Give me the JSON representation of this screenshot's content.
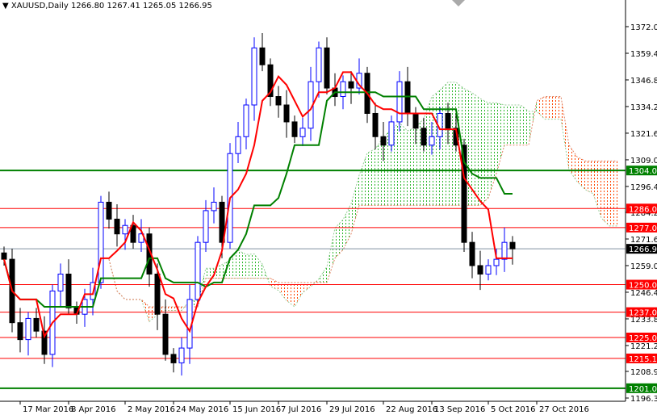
{
  "header": {
    "symbol": "XAUUSD,Daily",
    "ohlc": "1266.80 1267.41 1265.05 1266.95"
  },
  "chart_data": {
    "type": "candlestick",
    "title": "XAUUSD,Daily",
    "ylim": [
      1196.35,
      1372.05
    ],
    "y_ticks": [
      "1372.05",
      "1359.45",
      "1346.85",
      "1334.25",
      "1321.65",
      "1309.05",
      "1296.45",
      "1284.20",
      "1271.60",
      "1259.00",
      "1246.40",
      "1233.80",
      "1221.20",
      "1208.95",
      "1196.35"
    ],
    "x_ticks": [
      {
        "label": "17 Mar 2016",
        "i": 2
      },
      {
        "label": "8 Apr 2016",
        "i": 8
      },
      {
        "label": "2 May 2016",
        "i": 15
      },
      {
        "label": "24 May 2016",
        "i": 21
      },
      {
        "label": "15 Jun 2016",
        "i": 28
      },
      {
        "label": "7 Jul 2016",
        "i": 34
      },
      {
        "label": "29 Jul 2016",
        "i": 40
      },
      {
        "label": "22 Aug 2016",
        "i": 47
      },
      {
        "label": "13 Sep 2016",
        "i": 53
      },
      {
        "label": "5 Oct 2016",
        "i": 60
      },
      {
        "label": "27 Oct 2016",
        "i": 66
      }
    ],
    "closes": [
      1262,
      1232,
      1224,
      1234,
      1228,
      1217,
      1247,
      1255,
      1239,
      1236,
      1243,
      1251,
      1289,
      1281,
      1274,
      1278,
      1270,
      1274,
      1255,
      1236,
      1217,
      1213,
      1220,
      1243,
      1270,
      1285,
      1289,
      1270,
      1312,
      1320,
      1335,
      1362,
      1354,
      1339,
      1335,
      1327,
      1320,
      1324,
      1346,
      1362,
      1343,
      1339,
      1346,
      1343,
      1350,
      1331,
      1320,
      1316,
      1327,
      1346,
      1331,
      1324,
      1316,
      1320,
      1331,
      1324,
      1316,
      1270,
      1259,
      1255,
      1259,
      1262,
      1270,
      1266.95
    ],
    "levels": [
      {
        "price": 1304.0,
        "label": "1304.00",
        "color": "#008000"
      },
      {
        "price": 1286.0,
        "label": "1286.00",
        "color": "#ff0000"
      },
      {
        "price": 1277.0,
        "label": "1277.00",
        "color": "#ff0000"
      },
      {
        "price": 1266.95,
        "label": "1266.95",
        "color": "#000000"
      },
      {
        "price": 1250.0,
        "label": "1250.00",
        "color": "#ff0000"
      },
      {
        "price": 1237.0,
        "label": "1237.00",
        "color": "#ff0000"
      },
      {
        "price": 1225.0,
        "label": "1225.00",
        "color": "#ff0000"
      },
      {
        "price": 1215.1,
        "label": "1215.10",
        "color": "#ff0000"
      },
      {
        "price": 1201.0,
        "label": "1201.00",
        "color": "#008000"
      }
    ],
    "colors": {
      "bull": "#0000ff",
      "bear": "#000000",
      "tenkan": "#ff0000",
      "kijun": "#008000",
      "cloud_up": "#2eb82e",
      "cloud_down": "#ff4500"
    }
  }
}
